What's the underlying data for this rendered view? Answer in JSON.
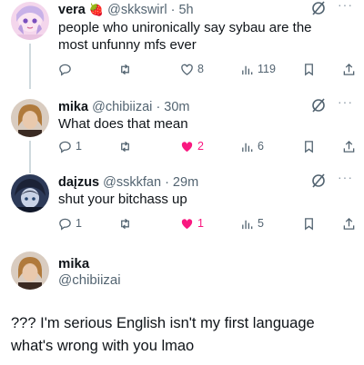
{
  "tweets": [
    {
      "name": "vera",
      "emoji": "🍓",
      "handle": "@skkswirl",
      "time": "· 5h",
      "text": "people who unironically say sybau are the most unfunny mfs ever",
      "replies": "",
      "retweets": "",
      "likes": "8",
      "views": "119",
      "liked": false
    },
    {
      "name": "mika",
      "handle": "@chibiizai",
      "time": "· 30m",
      "text": "What does that mean",
      "replies": "1",
      "retweets": "",
      "likes": "2",
      "views": "6",
      "liked": true
    },
    {
      "name": "daįzus",
      "handle": "@sskkfan",
      "time": "· 29m",
      "text": "shut your bitchass up",
      "replies": "1",
      "retweets": "",
      "likes": "1",
      "views": "5",
      "liked": true
    }
  ],
  "main_tweet": {
    "name": "mika",
    "handle": "@chibiizai",
    "text_line1": "??? I'm serious English isn't my first language",
    "text_line2": "what's wrong with you lmao"
  },
  "icons": {
    "reply": "reply-icon",
    "retweet": "retweet-icon",
    "like": "heart-icon",
    "views": "views-icon",
    "bookmark": "bookmark-icon",
    "share": "share-icon",
    "grok": "grok-icon",
    "more": "more-icon"
  },
  "colors": {
    "like_active": "#f91880",
    "muted": "#536471",
    "text": "#0f1419"
  }
}
